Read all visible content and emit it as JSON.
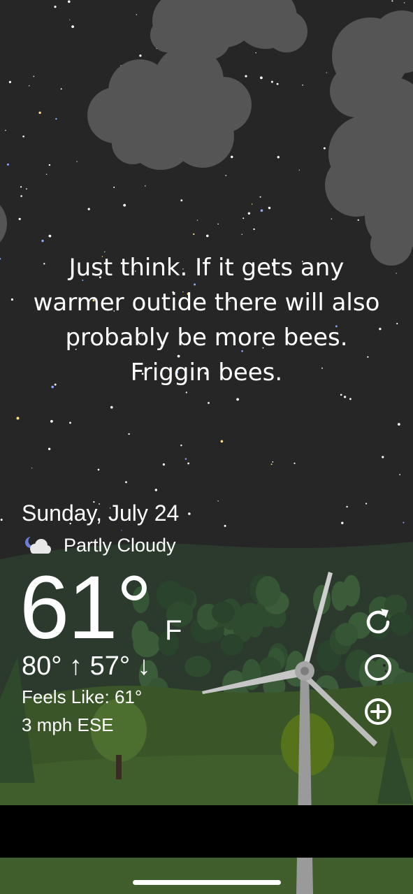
{
  "quote": {
    "line1": "Just think. If it gets any",
    "line2": "warmer outide there will also",
    "line3": "probably be more bees.",
    "line4": "Friggin bees."
  },
  "weather": {
    "date": "Sunday, July 24",
    "condition": "Partly Cloudy",
    "condition_icon": "partly-cloudy-night-icon",
    "temperature": "61°",
    "unit": "F",
    "high_low": "80° ↑  57° ↓",
    "feels_like": "Feels Like: 61°",
    "wind": "3 mph ESE"
  },
  "controls": {
    "refresh_icon": "refresh-icon",
    "theme_icon": "moon-theme-icon",
    "add_icon": "add-location-icon"
  },
  "colors": {
    "sky": "#262626",
    "cloud": "#555555",
    "hill_dark": "#2c3a2c",
    "grass": "#3d5a2a",
    "text": "#ffffff"
  }
}
